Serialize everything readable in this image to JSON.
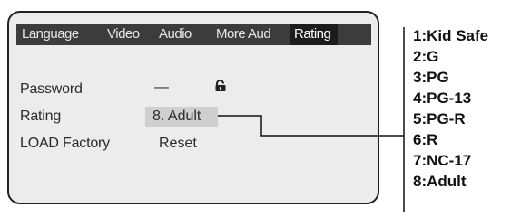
{
  "tabs": [
    {
      "label": "Language",
      "selected": false
    },
    {
      "label": "Video",
      "selected": false
    },
    {
      "label": "Audio",
      "selected": false
    },
    {
      "label": "More Aud",
      "selected": false
    },
    {
      "label": "Rating",
      "selected": true
    }
  ],
  "settings": {
    "password": {
      "label": "Password",
      "value": "—"
    },
    "rating": {
      "label": "Rating",
      "value": "8. Adult"
    },
    "load_factory": {
      "label": "LOAD Factory",
      "value": "Reset"
    }
  },
  "icons": {
    "lock": "lock-icon"
  },
  "rating_options": [
    "1:Kid Safe",
    "2:G",
    "3:PG",
    "4:PG-13",
    "5:PG-R",
    "6:R",
    "7:NC-17",
    "8:Adult"
  ]
}
